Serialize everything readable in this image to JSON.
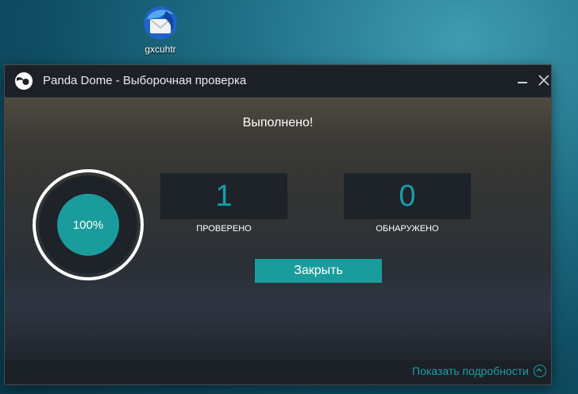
{
  "desktop": {
    "icon_label": "gxcuhtr",
    "icon_name": "thunderbird-mail-icon"
  },
  "window": {
    "title": "Panda Dome - Выборочная проверка",
    "logo_icon": "panda-logo-icon",
    "minimize_icon": "minimize-icon",
    "close_icon": "close-icon"
  },
  "scan": {
    "status": "Выполнено!",
    "progress_text": "100%",
    "progress_value": 100,
    "scanned_count": "1",
    "scanned_label": "ПРОВЕРЕНО",
    "found_count": "0",
    "found_label": "ОБНАРУЖЕНО",
    "close_button": "Закрыть"
  },
  "footer": {
    "details_link": "Показать подробности",
    "details_icon": "chevron-up-circle-icon"
  },
  "colors": {
    "accent": "#1a9c9c",
    "title_bar": "#1c2127",
    "stat_box": "#1e232a"
  }
}
